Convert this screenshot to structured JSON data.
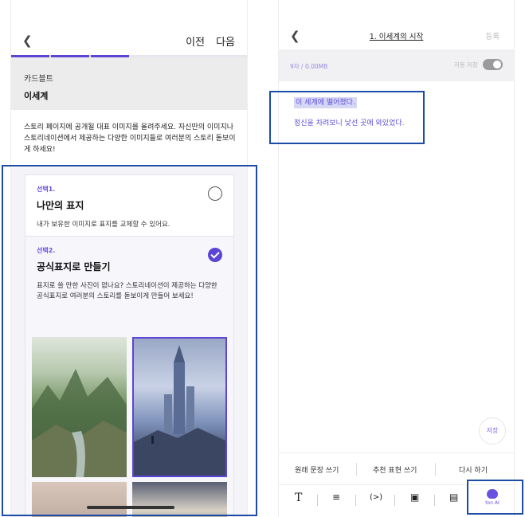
{
  "left": {
    "header": {
      "back_icon": "chevron-left-icon",
      "prev_label": "이전",
      "next_label": "다음"
    },
    "progress": {
      "segments_total": 4,
      "segments_done": 3,
      "accent": "#5b45d6"
    },
    "story": {
      "genre": "카드블트",
      "title": "이세계"
    },
    "description": "스토리 페이지에 공개될 대표 이미지를 올려주세요. 자신만의 이미지나 스토리네이션에서 제공하는 다양한 이미지들로 여러분의 스토리 돋보이게 하세요!",
    "options": [
      {
        "tag": "선택1.",
        "title": "나만의 표지",
        "text": "내가 보유한 이미지로 표지를 교체할 수 있어요.",
        "selected": false
      },
      {
        "tag": "선택2.",
        "title": "공식표지로 만들기",
        "text": "표지로 쓸 만한 사진이 없나요? 스토리네이션이 제공하는 다양한 공식표지로 여러분의 스토리를 돋보이게 만들어 보세요!",
        "selected": true
      }
    ]
  },
  "right": {
    "header": {
      "back_icon": "chevron-left-icon",
      "title": "1. 이세계의 시작",
      "register_label": "등록"
    },
    "info": {
      "count": "9자 / 0.00MB",
      "autosave_label": "자동 저장"
    },
    "body": {
      "line1": "이 세계에 떨어졌다.",
      "line2": "정신을 차려보니 낯선 곳에 와있었다."
    },
    "save_label": "저장",
    "actions": {
      "original": "원래 문장 쓰기",
      "recommend": "추천 표현 쓰기",
      "retry": "다시 하기"
    },
    "tools": {
      "ai_label": "ton AI"
    }
  },
  "colors": {
    "accent": "#5b45d6",
    "highlight_border": "#1c4ca6"
  }
}
